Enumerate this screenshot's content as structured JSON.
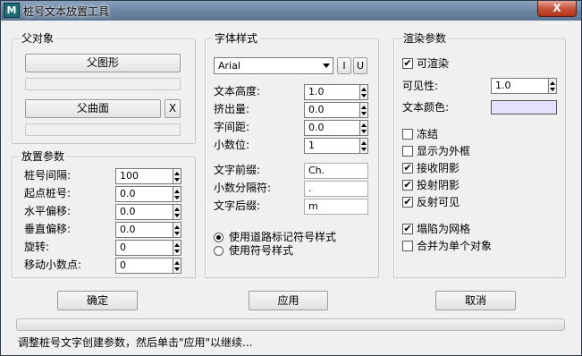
{
  "window": {
    "title": "桩号文本放置工具",
    "icon_label": "M",
    "close_label": "X"
  },
  "parent_object": {
    "legend": "父对象",
    "parent_shape_button": "父图形",
    "parent_shape_value": "",
    "parent_curve_button": "父曲面",
    "parent_curve_clear": "X",
    "parent_curve_value": ""
  },
  "placement": {
    "legend": "放置参数",
    "rows": [
      {
        "label": "桩号间隔:",
        "value": "100"
      },
      {
        "label": "起点桩号:",
        "value": "0.0"
      },
      {
        "label": "水平偏移:",
        "value": "0.0"
      },
      {
        "label": "垂直偏移:",
        "value": "0.0"
      },
      {
        "label": "旋转:",
        "value": "0"
      },
      {
        "label": "移动小数点:",
        "value": "0"
      }
    ]
  },
  "font_style": {
    "legend": "字体样式",
    "font_name": "Arial",
    "italic_label": "I",
    "underline_label": "U",
    "spinners": [
      {
        "label": "文本高度:",
        "value": "1.0"
      },
      {
        "label": "挤出量:",
        "value": "0.0"
      },
      {
        "label": "字间距:",
        "value": "0.0"
      },
      {
        "label": "小数位:",
        "value": "1"
      }
    ],
    "prefix_label": "文字前缀:",
    "prefix_value": "Ch.",
    "decimal_sep_label": "小数分隔符:",
    "decimal_sep_value": ".",
    "suffix_label": "文字后缀:",
    "suffix_value": "m",
    "radio_options": [
      {
        "label": "使用道路标记符号样式",
        "selected": true
      },
      {
        "label": "使用符号样式",
        "selected": false
      }
    ]
  },
  "render": {
    "legend": "渲染参数",
    "renderable_label": "可渲染",
    "renderable_checked": true,
    "visibility_label": "可见性:",
    "visibility_value": "1.0",
    "text_color_label": "文本颜色:",
    "text_color": "#e6e1fb",
    "checkboxes": [
      {
        "label": "冻结",
        "checked": false
      },
      {
        "label": "显示为外框",
        "checked": false
      },
      {
        "label": "接收阴影",
        "checked": true
      },
      {
        "label": "投射阴影",
        "checked": true
      },
      {
        "label": "反射可见",
        "checked": true
      }
    ],
    "checkboxes2": [
      {
        "label": "塌陷为网格",
        "checked": true
      },
      {
        "label": "合并为单个对象",
        "checked": false
      }
    ]
  },
  "actions": {
    "ok_label": "确定",
    "apply_label": "应用",
    "cancel_label": "取消"
  },
  "progress": {
    "value": 0
  },
  "status_text": "调整桩号文字创建参数，然后单击\"应用\"以继续...",
  "check_mark": "✔"
}
